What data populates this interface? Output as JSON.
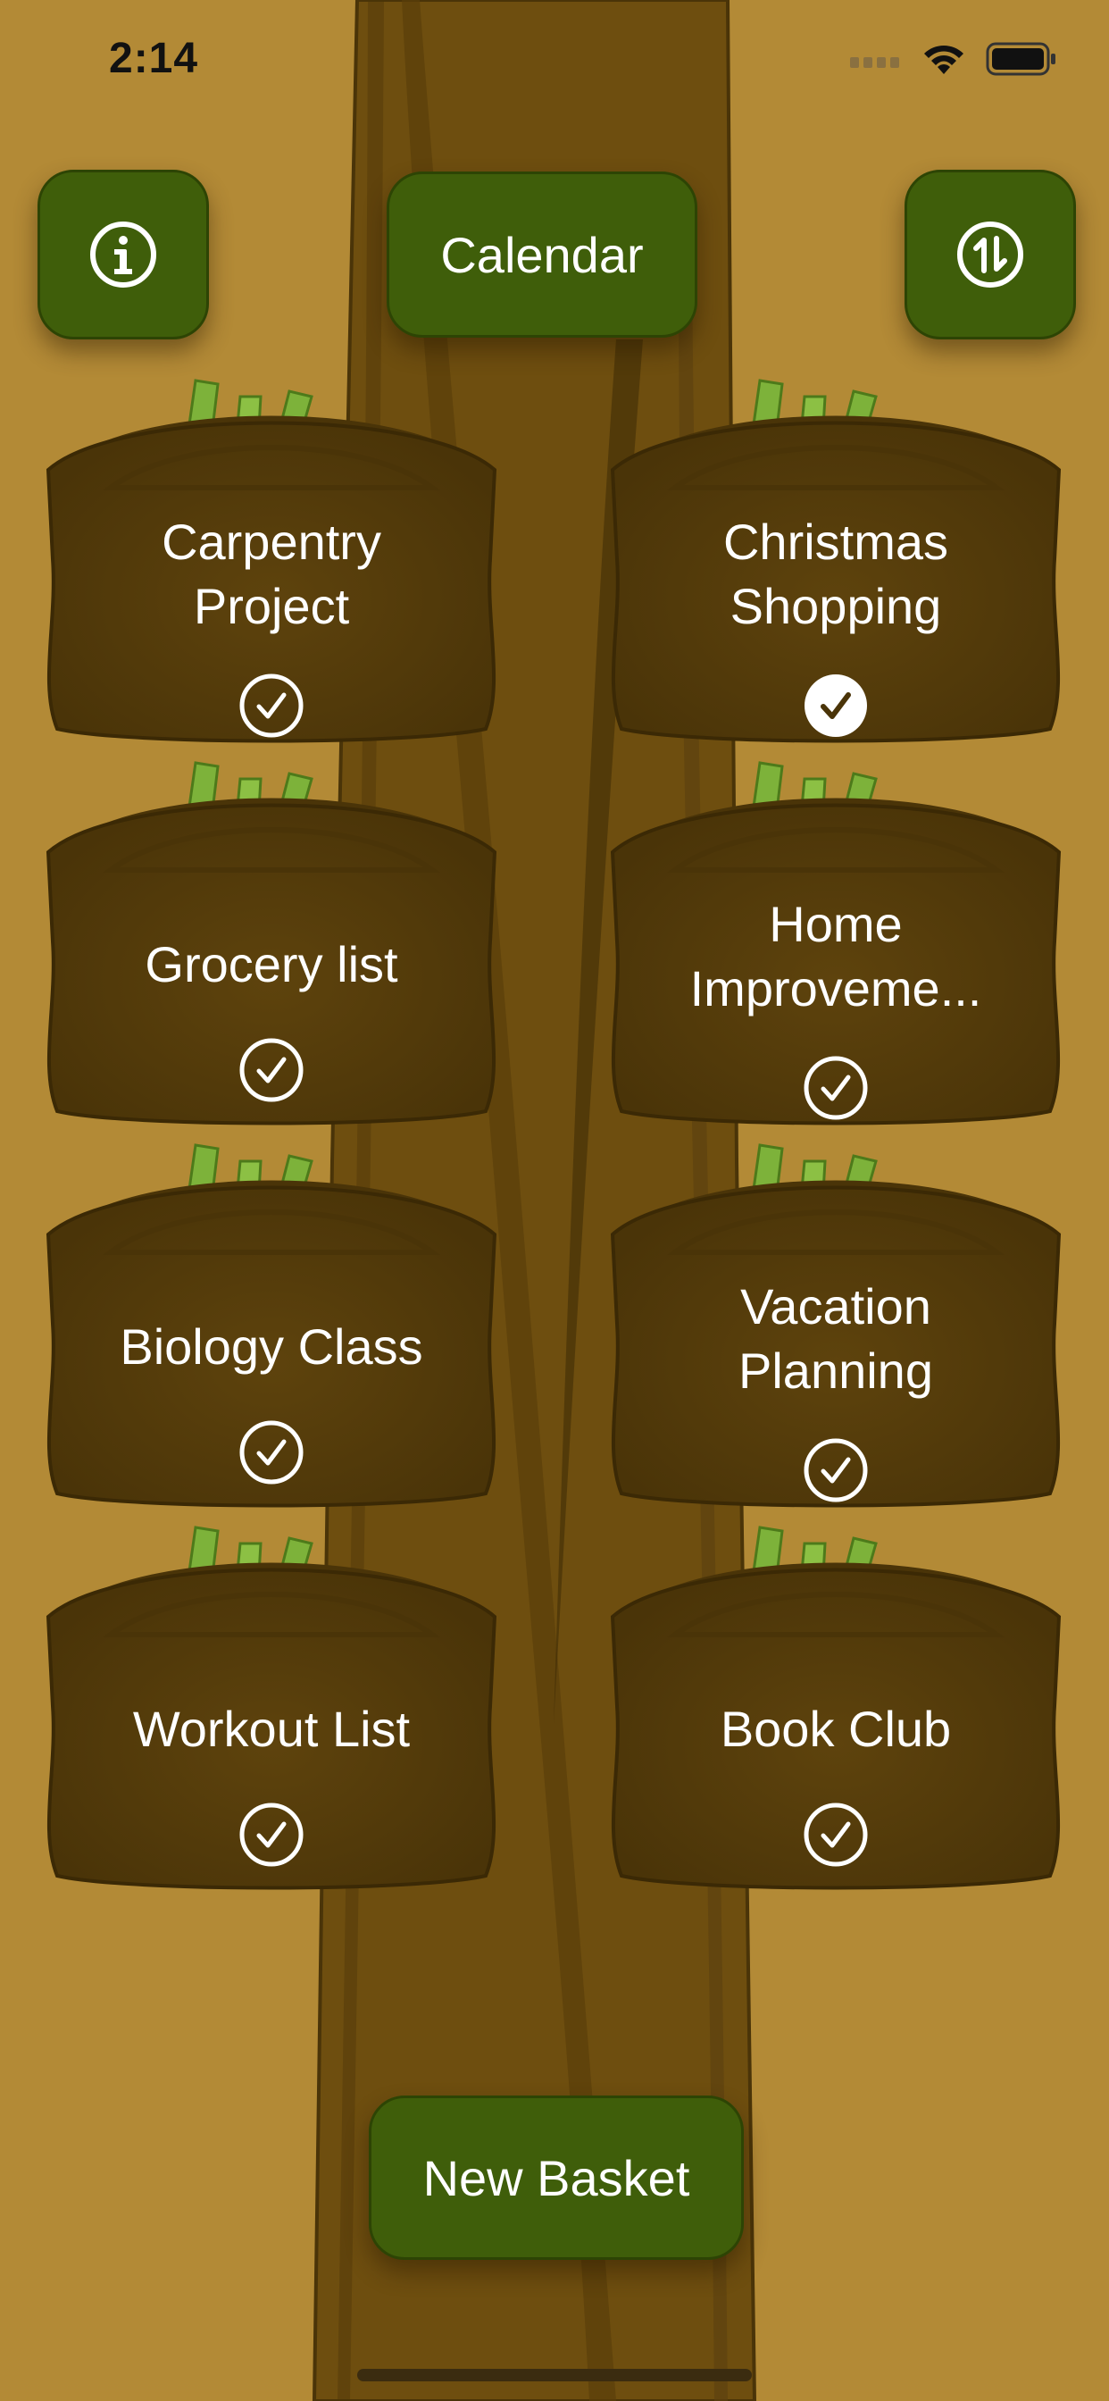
{
  "status_bar": {
    "time": "2:14"
  },
  "header": {
    "info_icon": "info-circle-icon",
    "calendar_label": "Calendar",
    "sync_icon": "sync-arrows-icon"
  },
  "baskets": [
    {
      "title": "Carpentry Project",
      "line1": "Carpentry",
      "line2": "Project",
      "checked": false
    },
    {
      "title": "Christmas Shopping",
      "line1": "Christmas",
      "line2": "Shopping",
      "checked": true
    },
    {
      "title": "Grocery list",
      "checked": false
    },
    {
      "title": "Home Improveme...",
      "line1": "Home",
      "line2": "Improveme...",
      "checked": false
    },
    {
      "title": "Biology Class",
      "checked": false
    },
    {
      "title": "Vacation Planning",
      "line1": "Vacation",
      "line2": "Planning",
      "checked": false
    },
    {
      "title": "Workout List",
      "checked": false
    },
    {
      "title": "Book Club",
      "checked": false
    }
  ],
  "footer": {
    "new_basket_label": "New Basket"
  },
  "colors": {
    "background": "#b38a36",
    "trunk": "#6e4e0f",
    "button_green": "#3f5e0a",
    "basket_brown": "#5a400c",
    "leek_green": "#7db23a"
  }
}
